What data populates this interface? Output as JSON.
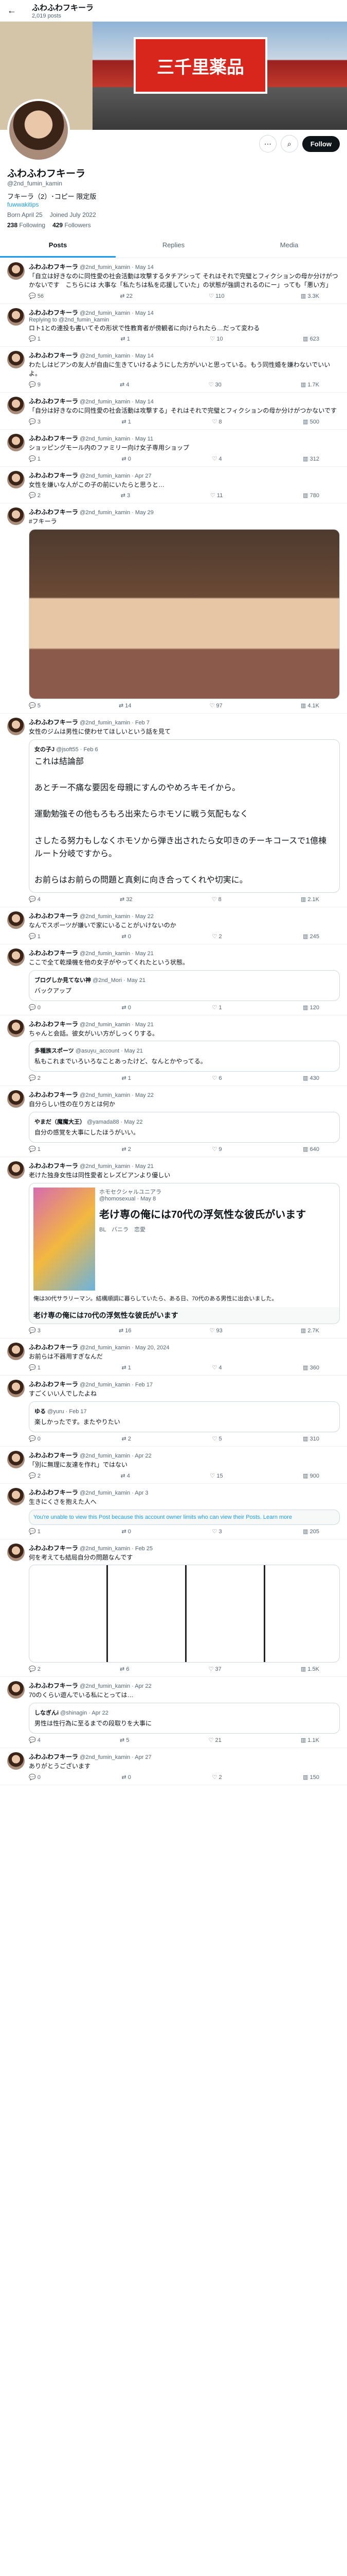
{
  "header": {
    "name": "ふわふわフキーラ",
    "posts": "2,019 posts"
  },
  "banner": {
    "sign": "三千里薬品"
  },
  "actions": {
    "more": "⋯",
    "search": "⌕",
    "follow": "Follow"
  },
  "profile": {
    "name": "ふわふわフキーラ",
    "handle": "@2nd_fumin_kamin",
    "bio": "フキーラ（2）･コピー 限定版",
    "link": "fuwwakitips",
    "born": "Born April 25",
    "joined": "Joined July 2022",
    "following": "238",
    "following_label": "Following",
    "followers": "429",
    "followers_label": "Followers"
  },
  "tabs": [
    "Posts",
    "Replies",
    "Media"
  ],
  "tweets": [
    {
      "name": "ふわふわフキーラ",
      "meta": "@2nd_fumin_kamin · May 14",
      "text": "「自立は好きなのに同性愛の社会活動は攻撃するタチアシって それはそれで完璧とフィクションの母か分けがつかないです　こちらには 大事な「私たちは私を応援していた」の状態が強調されるのにー」っても「悪い方」",
      "eng": [
        "56",
        "22",
        "110",
        "3.3K"
      ]
    },
    {
      "name": "ふわふわフキーラ",
      "meta": "@2nd_fumin_kamin · May 14",
      "reply": "Replying to @2nd_fumin_kamin",
      "text": "ロト1との連投も書いてその形状で性教育者が傍観者に向けられたら…だって変わる",
      "eng": [
        "1",
        "1",
        "10",
        "623"
      ]
    },
    {
      "name": "ふわふわフキーラ",
      "meta": "@2nd_fumin_kamin · May 14",
      "text": "わたしはビアンの友人が自由に生きていけるようにした方がいいと思っている。もう同性婚を嫌わないでいいよ。",
      "eng": [
        "9",
        "4",
        "30",
        "1.7K"
      ]
    },
    {
      "name": "ふわふわフキーラ",
      "meta": "@2nd_fumin_kamin · May 14",
      "text": "「自分は好きなのに同性愛の社会活動は攻撃する」それはそれで完璧とフィクションの母か分けがつかないです",
      "eng": [
        "3",
        "1",
        "8",
        "500"
      ]
    },
    {
      "name": "ふわふわフキーラ",
      "meta": "@2nd_fumin_kamin · May 11",
      "text": "ショッピングモール内のファミリー向け女子専用ショップ",
      "eng": [
        "1",
        "0",
        "4",
        "312"
      ]
    },
    {
      "name": "ふわふわフキーラ",
      "meta": "@2nd_fumin_kamin · Apr 27",
      "text": "女性を嫌いな人がこの子の前にいたらと思うと…",
      "eng": [
        "2",
        "3",
        "11",
        "780"
      ]
    },
    {
      "name": "ふわふわフキーラ",
      "meta": "@2nd_fumin_kamin · May 29",
      "text": "#フキーラ",
      "media": true,
      "eng": [
        "5",
        "14",
        "97",
        "4.1K"
      ]
    },
    {
      "name": "ふわふわフキーラ",
      "meta": "@2nd_fumin_kamin · Feb 7",
      "text": "女性のジムは男性に使わせてほしいという話を見て",
      "quote": {
        "name": "女の子J",
        "handle": "@jsoft55 · Feb 6",
        "text": "これは結論部\n\nあとチー不痛な要因を母親にすんのやめろキモイから。\n\n運動勉強その他もろもろ出来たらホモソに戦う気配もなく\n\nさしたる努力もしなくホモソから弾き出されたら女叩きのチーキコースで1億棟ルート分岐ですから。\n\nお前らはお前らの問題と真剣に向き合ってくれや切実に。",
        "big": true
      },
      "eng": [
        "4",
        "32",
        "8",
        "2.1K"
      ]
    },
    {
      "name": "ふわふわフキーラ",
      "meta": "@2nd_fumin_kamin · May 22",
      "text": "なんでスポーツが嫌いで家にいることがいけないのか",
      "eng": [
        "1",
        "0",
        "2",
        "245"
      ]
    },
    {
      "name": "ふわふわフキーラ",
      "meta": "@2nd_fumin_kamin · May 21",
      "text": "ここで全て乾燥機を他の女子がやってくれたという状態。",
      "quote": {
        "name": "ブログしか見てない神",
        "handle": "@2nd_Mori · May 21",
        "text": "バックアップ",
        "big": false
      },
      "eng": [
        "0",
        "0",
        "1",
        "120"
      ]
    },
    {
      "name": "ふわふわフキーラ",
      "meta": "@2nd_fumin_kamin · May 21",
      "text": "ちゃんと会話。彼女がいい方がしっくりする。",
      "quote": {
        "name": "多種族スポーツ",
        "handle": "@asuyu_account · May 21",
        "text": "私もこれまでいろいろなことあったけど、なんとかやってる。",
        "big": false
      },
      "eng": [
        "2",
        "1",
        "6",
        "430"
      ]
    },
    {
      "name": "ふわふわフキーラ",
      "meta": "@2nd_fumin_kamin · May 22",
      "text": "自分らしい性の在り方とは何か",
      "quote": {
        "name": "やまだ（魔魔大王）",
        "handle": "@yamada88 · May 22",
        "text": "自分の感覚を大事にしたほうがいい。",
        "big": false
      },
      "eng": [
        "1",
        "2",
        "9",
        "640"
      ]
    },
    {
      "name": "ふわふわフキーラ",
      "meta": "@2nd_fumin_kamin · May 21",
      "text": "老けた独身女性は同性愛者とレズビアンより優しい",
      "manga": {
        "name": "ホモセクシャルユニアラ",
        "handle": "@homosexual · May 8",
        "title": "老け専の俺には70代の浮気性な彼氏がいます",
        "tags": "BL　バニラ　恋愛",
        "body": "俺は30代サラリーマン。結構順調に暮らしていたら、ある日、70代のある男性に出会いました。",
        "caption": "老け専の俺には70代の浮気性な彼氏がいます"
      },
      "eng": [
        "3",
        "16",
        "93",
        "2.7K"
      ]
    },
    {
      "name": "ふわふわフキーラ",
      "meta": "@2nd_fumin_kamin · May 20, 2024",
      "text": "お前らは不器用すぎなんだ",
      "eng": [
        "1",
        "1",
        "4",
        "360"
      ]
    },
    {
      "name": "ふわふわフキーラ",
      "meta": "@2nd_fumin_kamin · Feb 17",
      "text": "すごくいい人でしたよね",
      "quote": {
        "name": "ゆる",
        "handle": "@yuru · Feb 17",
        "text": "楽しかったです。またやりたい",
        "big": false
      },
      "eng": [
        "0",
        "2",
        "5",
        "310"
      ]
    },
    {
      "name": "ふわふわフキーラ",
      "meta": "@2nd_fumin_kamin · Apr 22",
      "text": "「別に無理に友達を作れ」ではない",
      "eng": [
        "2",
        "4",
        "15",
        "900"
      ]
    },
    {
      "name": "ふわふわフキーラ",
      "meta": "@2nd_fumin_kamin · Apr 3",
      "text": "生きにくさを抱えた人へ",
      "notice": "You're unable to view this Post because this account owner limits who can view their Posts.",
      "notice_link": "Learn more",
      "eng": [
        "1",
        "0",
        "3",
        "205"
      ]
    },
    {
      "name": "ふわふわフキーラ",
      "meta": "@2nd_fumin_kamin · Feb 25",
      "text": "何を考えても結局自分の問題なんです",
      "manga2": true,
      "eng": [
        "2",
        "6",
        "37",
        "1.5K"
      ]
    },
    {
      "name": "ふわふわフキーラ",
      "meta": "@2nd_fumin_kamin · Apr 22",
      "text": "70のくらい遊んでいる私にとっては…",
      "quote": {
        "name": "しなぎんi",
        "handle": "@shinagin · Apr 22",
        "text": "男性は性行為に至るまでの段取りを大事に",
        "big": false
      },
      "eng": [
        "4",
        "5",
        "21",
        "1.1K"
      ]
    },
    {
      "name": "ふわふわフキーラ",
      "meta": "@2nd_fumin_kamin · Apr 27",
      "text": "ありがとうございます",
      "eng": [
        "0",
        "0",
        "2",
        "150"
      ]
    }
  ]
}
